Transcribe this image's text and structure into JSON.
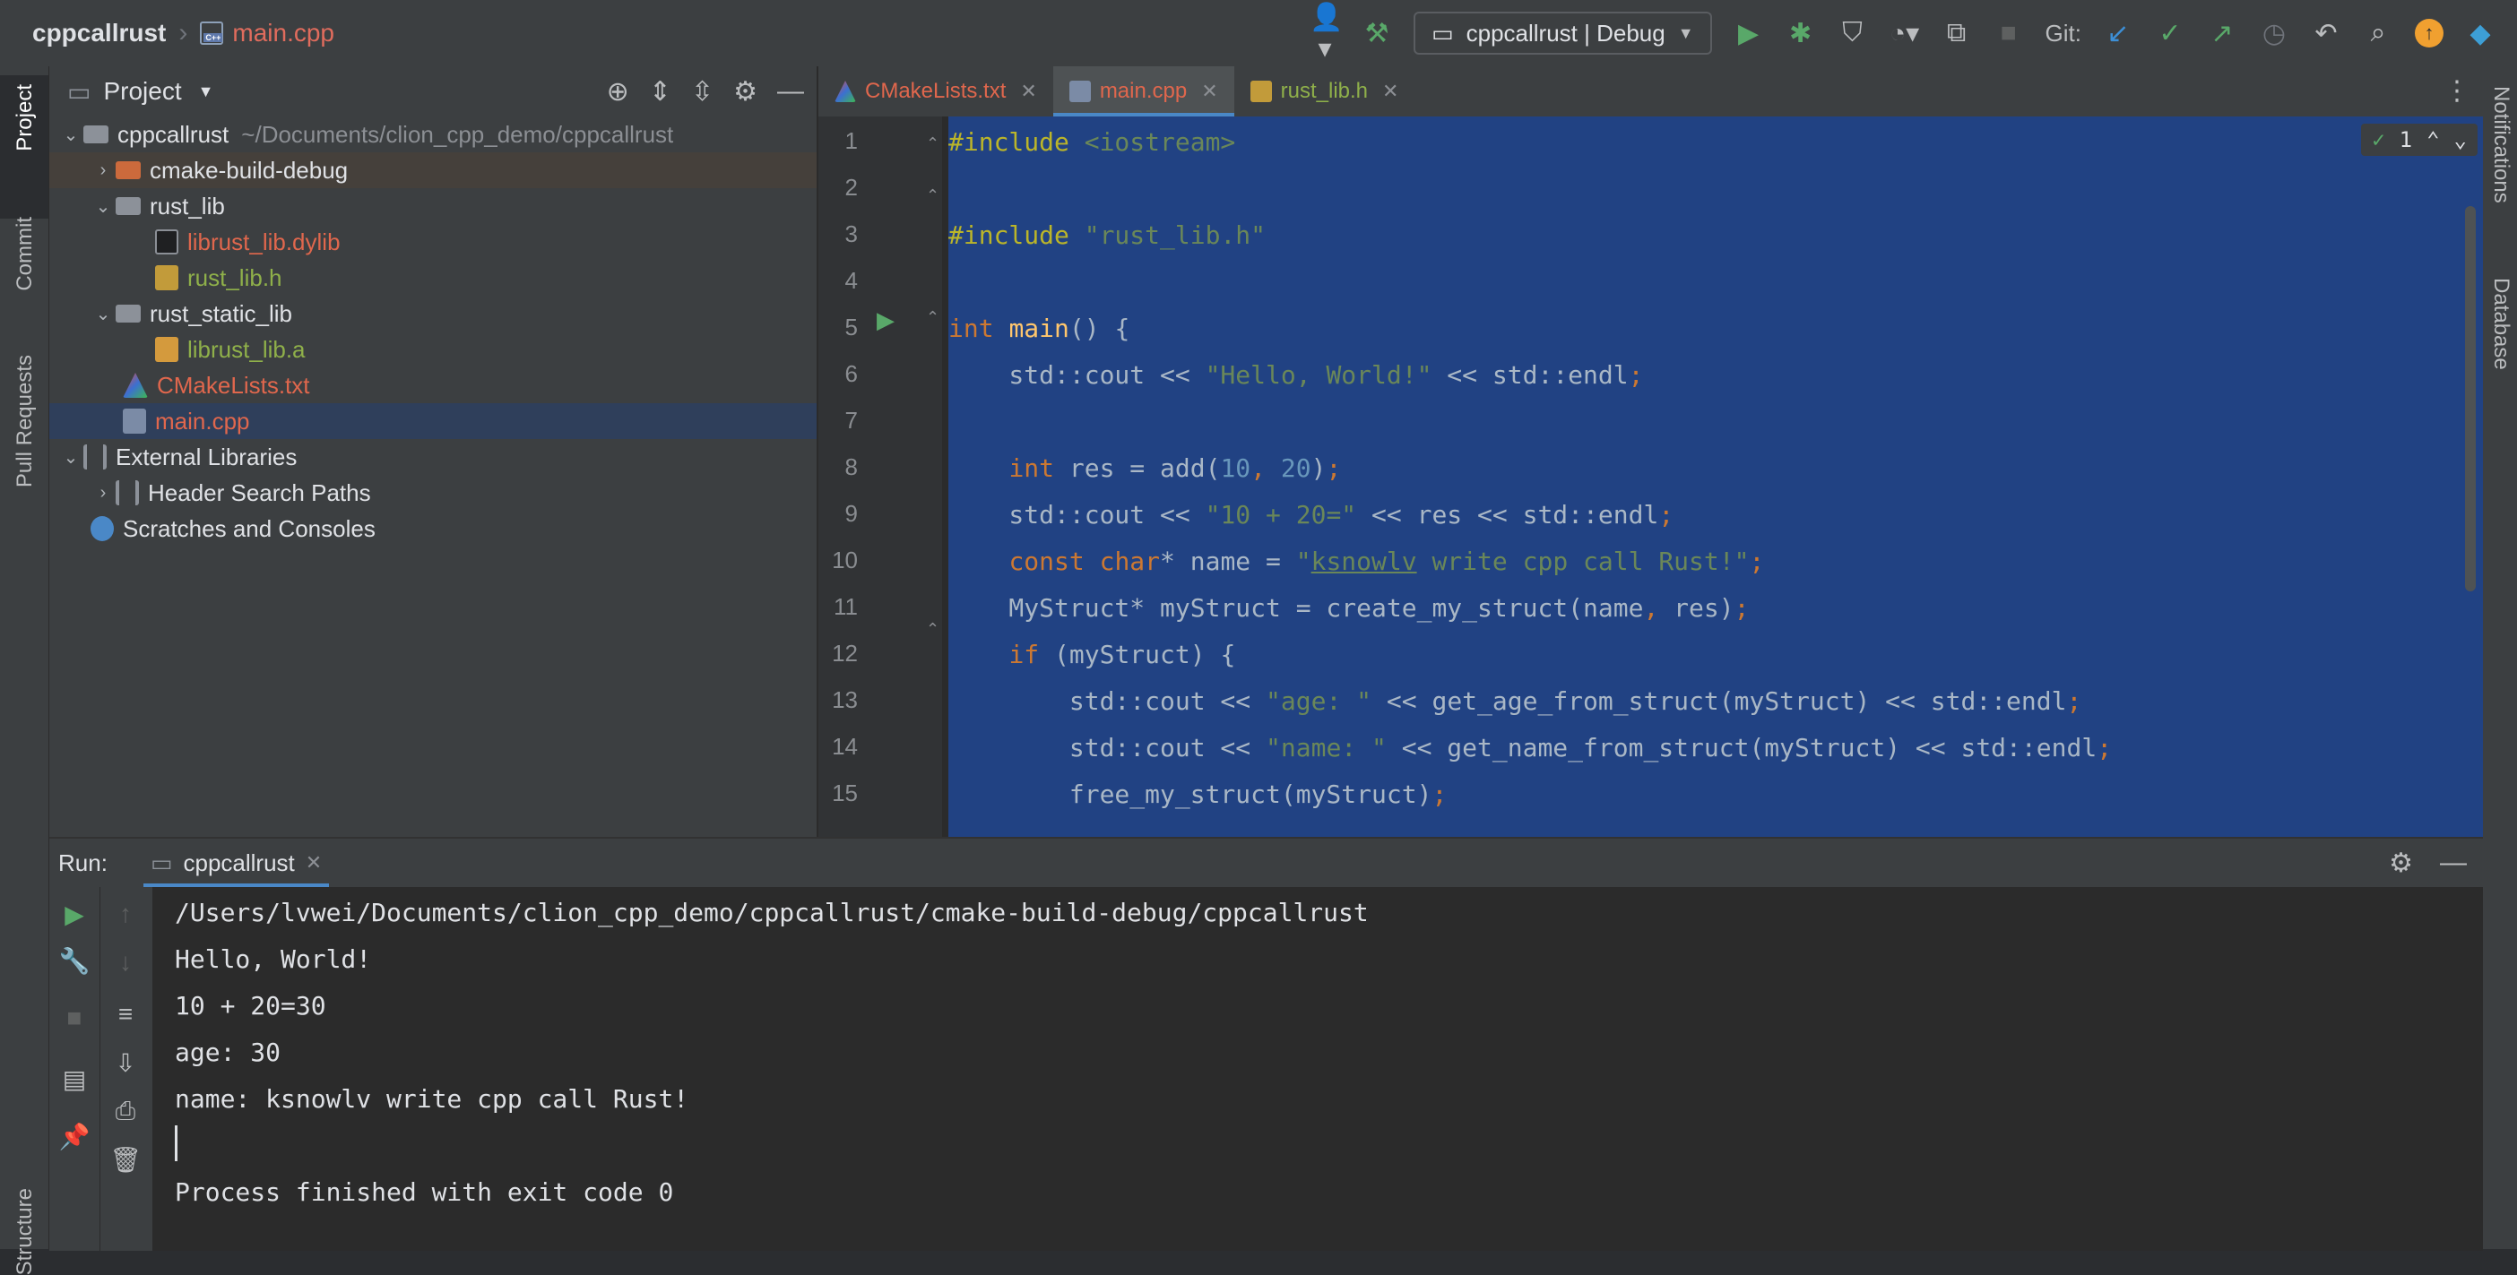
{
  "navbar": {
    "project": "cppcallrust",
    "file": "main.cpp",
    "run_config": "cppcallrust | Debug",
    "git_label": "Git:"
  },
  "left_stripe": {
    "project": "Project",
    "commit": "Commit",
    "pull_requests": "Pull Requests",
    "structure": "Structure"
  },
  "right_stripe": {
    "notifications": "Notifications",
    "database": "Database"
  },
  "project_panel": {
    "title": "Project",
    "tree": [
      {
        "label": "cppcallrust",
        "path": "~/Documents/clion_cpp_demo/cppcallrust"
      },
      {
        "label": "cmake-build-debug"
      },
      {
        "label": "rust_lib"
      },
      {
        "label": "librust_lib.dylib"
      },
      {
        "label": "rust_lib.h"
      },
      {
        "label": "rust_static_lib"
      },
      {
        "label": "librust_lib.a"
      },
      {
        "label": "CMakeLists.txt"
      },
      {
        "label": "main.cpp"
      },
      {
        "label": "External Libraries"
      },
      {
        "label": "Header Search Paths"
      },
      {
        "label": "Scratches and Consoles"
      }
    ]
  },
  "editor": {
    "tabs": [
      {
        "label": "CMakeLists.txt"
      },
      {
        "label": "main.cpp"
      },
      {
        "label": "rust_lib.h"
      }
    ],
    "inspection_count": "1",
    "line_numbers": [
      "1",
      "2",
      "3",
      "4",
      "5",
      "6",
      "7",
      "8",
      "9",
      "10",
      "11",
      "12",
      "13",
      "14",
      "15"
    ]
  },
  "run_panel": {
    "label": "Run:",
    "tab": "cppcallrust",
    "output": [
      "/Users/lvwei/Documents/clion_cpp_demo/cppcallrust/cmake-build-debug/cppcallrust",
      "Hello, World!",
      "10 + 20=30",
      "age: 30",
      "name: ksnowlv write cpp call Rust!",
      "",
      "Process finished with exit code 0"
    ]
  }
}
